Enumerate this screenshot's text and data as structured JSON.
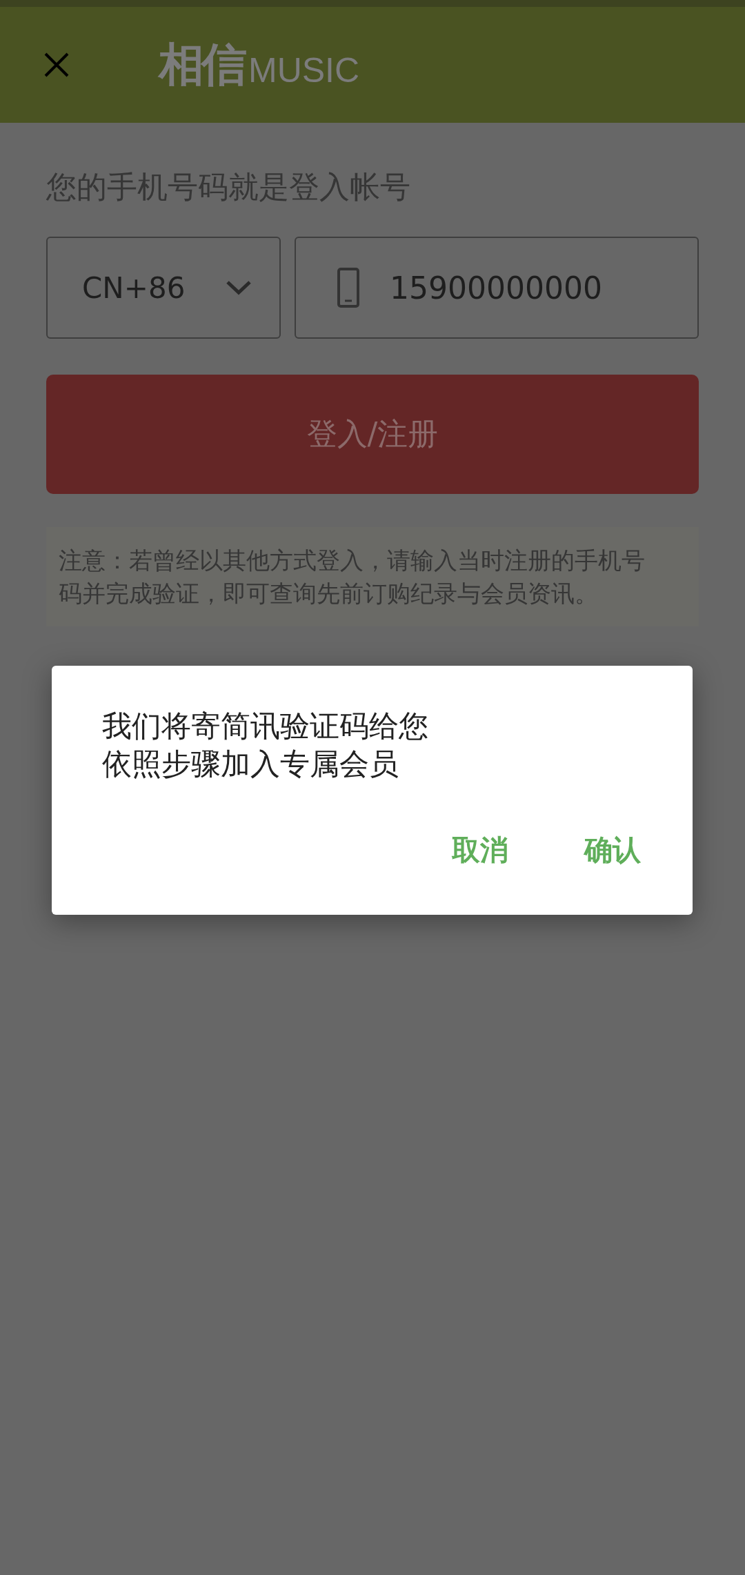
{
  "header": {
    "logo_mark": "相信",
    "logo_word": "MUSIC"
  },
  "prompt": "您的手机号码就是登入帐号",
  "country_select": {
    "value": "CN+86"
  },
  "phone_field": {
    "value": "15900000000"
  },
  "login_button": {
    "label": "登入/注册",
    "disabled": true
  },
  "notice": "注意：若曾经以其他方式登入，请输入当时注册的手机号码并完成验证，即可查询先前订购纪录与会员资讯。",
  "dialog": {
    "message": [
      "我们将寄简讯验证码给您",
      "依照步骤加入专属会员"
    ],
    "buttons": [
      {
        "label": "取消"
      },
      {
        "label": "确认"
      }
    ]
  }
}
